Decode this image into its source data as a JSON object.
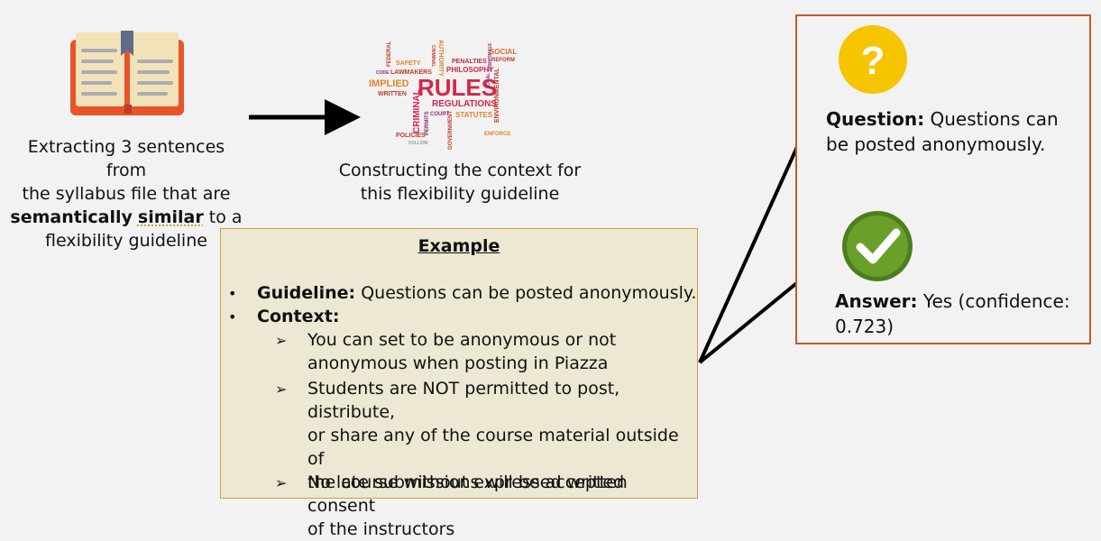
{
  "left_caption": {
    "line1": "Extracting 3 sentences from",
    "line2": "the syllabus file that are",
    "bold1": "semantically",
    "bold2": "similar",
    "line3_tail": "to a",
    "line4": "flexibility guideline"
  },
  "mid_caption": {
    "line1": "Constructing the context for",
    "line2": "this flexibility guideline"
  },
  "word_cloud": {
    "big": "RULES",
    "words": [
      "SOCIAL",
      "REFORM",
      "STANDARDS",
      "CRIMINAL",
      "AUTHORITY",
      "FEDERAL",
      "SAFETY",
      "PENALTIES",
      "CODE",
      "LAWMAKERS",
      "PHILOSOPHY",
      "IMPLIED",
      "WRITTEN",
      "REGULATIONS",
      "LOCAL",
      "ENVIRONMENTAL",
      "COURT",
      "STATUTES",
      "CRIMINAL",
      "PERMITS",
      "GOVERNMENT",
      "POLICIES",
      "FOLLOW",
      "ENFORCE"
    ]
  },
  "example": {
    "title": "Example",
    "guideline_label": "Guideline:",
    "guideline_text": "Questions can be posted anonymously.",
    "context_label": "Context:",
    "items": [
      [
        "You can set to be anonymous or not",
        "anonymous when posting in Piazza"
      ],
      [
        "Students are NOT permitted to post, distribute,",
        "or share any of the course material outside of",
        "the course without expressed written consent",
        "of the instructors"
      ],
      [
        "No late submissions will be accepted"
      ]
    ]
  },
  "result": {
    "question_icon": "?",
    "question_label": "Question:",
    "question_text1": "Questions can",
    "question_text2": "be posted anonymously.",
    "answer_label": "Answer:",
    "answer_text1": "Yes (confidence:",
    "answer_text2": "0.723)"
  },
  "colors": {
    "book_cover": "#e8542a",
    "question_circle": "#f7c400",
    "check_circle": "#6aa02a",
    "result_border": "#c55a28",
    "example_bg": "#ece8d3",
    "example_border": "#c9a23a"
  },
  "icons": [
    "book-icon",
    "word-cloud-icon",
    "question-mark-icon",
    "checkmark-icon"
  ]
}
